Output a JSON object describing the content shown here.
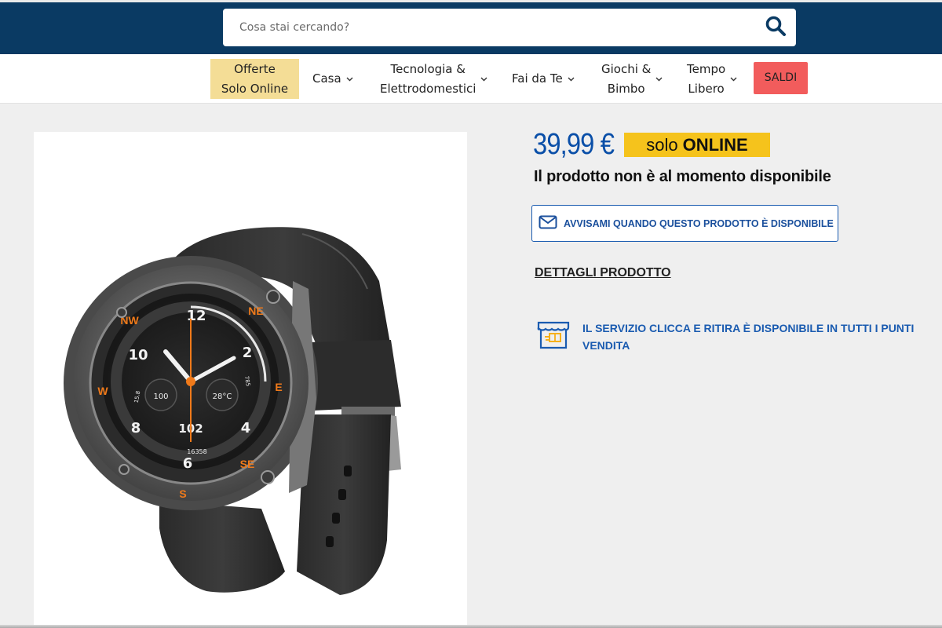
{
  "search": {
    "placeholder": "Cosa stai cercando?",
    "icon": "search-icon"
  },
  "nav": {
    "items": [
      {
        "label_line1": "Offerte",
        "label_line2": "Solo Online"
      },
      {
        "label": "Casa"
      },
      {
        "label_line1": "Tecnologia &",
        "label_line2": "Elettrodomestici"
      },
      {
        "label": "Fai da Te"
      },
      {
        "label_line1": "Giochi &",
        "label_line2": "Bimbo"
      },
      {
        "label_line1": "Tempo",
        "label_line2": "Libero"
      },
      {
        "label": "SALDI"
      }
    ]
  },
  "product": {
    "price": "39,99 €",
    "badge_a": "solo",
    "badge_b": "ONLINE",
    "availability": "Il prodotto non è al momento disponibile",
    "notify_label": "AVVISAMI QUANDO QUESTO PRODOTTO È DISPONIBILE",
    "details_label": "DETTAGLI PRODOTTO",
    "service_text": "IL SERVIZIO CLICCA E RITIRA  È DISPONIBILE  IN TUTTI I PUNTI VENDITA"
  },
  "watch_face": {
    "numbers": [
      "12",
      "2",
      "4",
      "6",
      "8",
      "10"
    ],
    "compass": [
      "NE",
      "E",
      "SE",
      "S",
      "W",
      "NW"
    ],
    "readouts": [
      "100",
      "28°C",
      "102",
      "16358",
      "15.8",
      "785"
    ]
  },
  "colors": {
    "header_bg": "#0a3a63",
    "offerte_bg": "#f4dd96",
    "saldi_bg": "#f25c5c",
    "price": "#0a4fa8",
    "online_badge": "#f5c31c",
    "link_blue": "#1a5bb0",
    "accent_orange": "#f07a1a"
  }
}
